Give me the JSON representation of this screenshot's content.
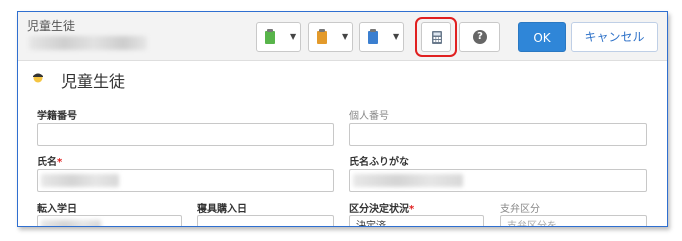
{
  "header": {
    "title": "児童生徒",
    "ok_label": "OK",
    "cancel_label": "キャンセル",
    "toolbar_icons": [
      "green-clipboard-icon",
      "orange-clipboard-icon",
      "blue-clipboard-icon",
      "calculator-icon",
      "help-icon"
    ],
    "help_glyph": "?",
    "dropdown_caret": "▼"
  },
  "page": {
    "title": "児童生徒"
  },
  "form": {
    "student_number_label": "学籍番号",
    "personal_number_label": "個人番号",
    "name_label": "氏名",
    "name_kana_label": "氏名ふりがな",
    "transfer_date_label": "転入学日",
    "bedding_purchase_label": "寝具購入日",
    "classification_status_label": "区分決定状況",
    "payment_category_label": "支弁区分",
    "required_mark": "*",
    "classification_status_value": "決定済",
    "payment_category_placeholder": "支弁区分を"
  },
  "colors": {
    "accent": "#2f86d8",
    "highlight": "#e02020",
    "frame": "#2f6fd0"
  }
}
